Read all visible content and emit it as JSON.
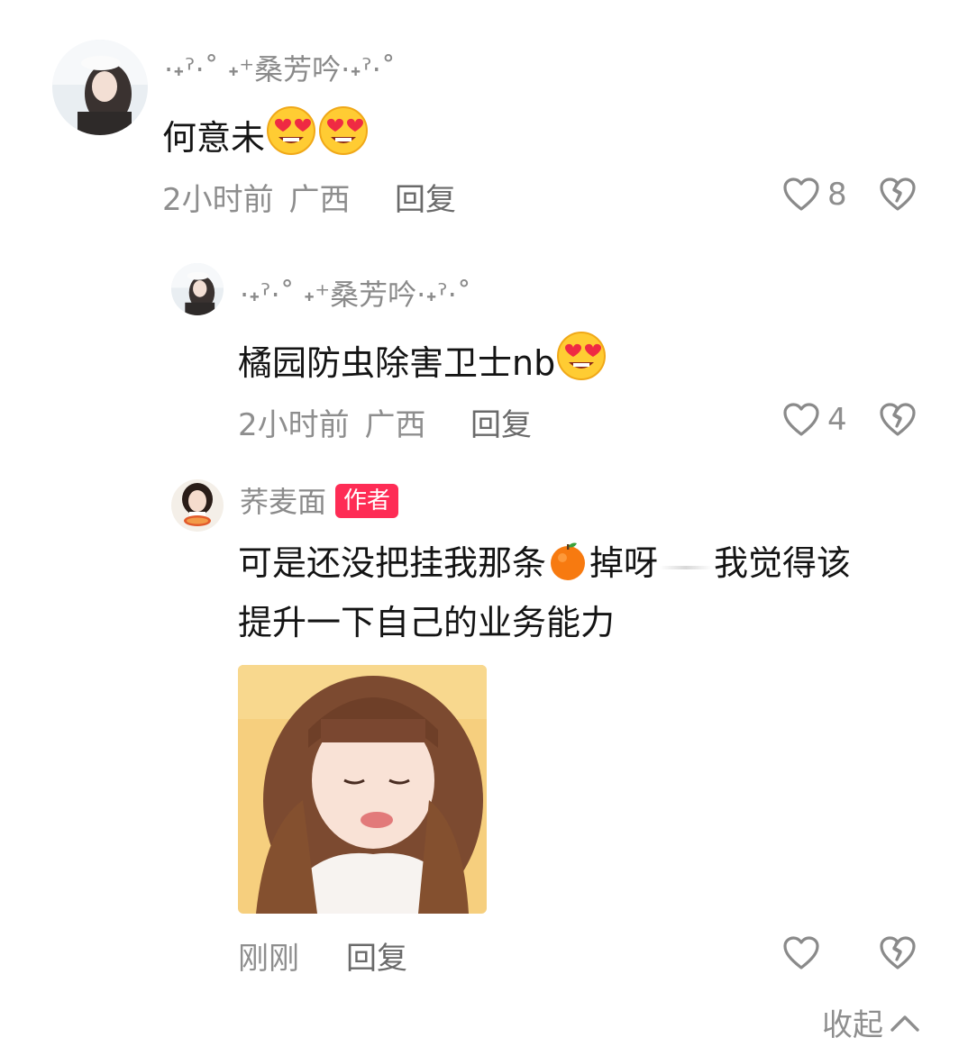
{
  "comments": [
    {
      "username": "·˖ˀ⋅˚ ˖⁺桑芳吟·˖ˀ⋅˚",
      "text": "何意未",
      "emojis": [
        "heart-eyes-emoji",
        "heart-eyes-emoji"
      ],
      "time": "2小时前",
      "location": "广西",
      "reply_label": "回复",
      "likes": "8"
    },
    {
      "username": "·˖ˀ⋅˚ ˖⁺桑芳吟·˖ˀ⋅˚",
      "text": "橘园防虫除害卫士nb",
      "emojis": [
        "heart-eyes-emoji"
      ],
      "time": "2小时前",
      "location": "广西",
      "reply_label": "回复",
      "likes": "4"
    },
    {
      "username": "荞麦面",
      "badge": "作者",
      "text_line1_a": "可是还没把挂我那条",
      "text_line1_b": "掉呀",
      "text_line1_c": "我觉得该",
      "text_line2": "提升一下自己的业务能力",
      "emojis": [
        "orange-emoji"
      ],
      "time": "刚刚",
      "reply_label": "回复",
      "likes": ""
    }
  ],
  "footer": {
    "collapse_label": "收起"
  },
  "colors": {
    "badge": "#fe2c55",
    "meta": "#8e8e8e"
  }
}
